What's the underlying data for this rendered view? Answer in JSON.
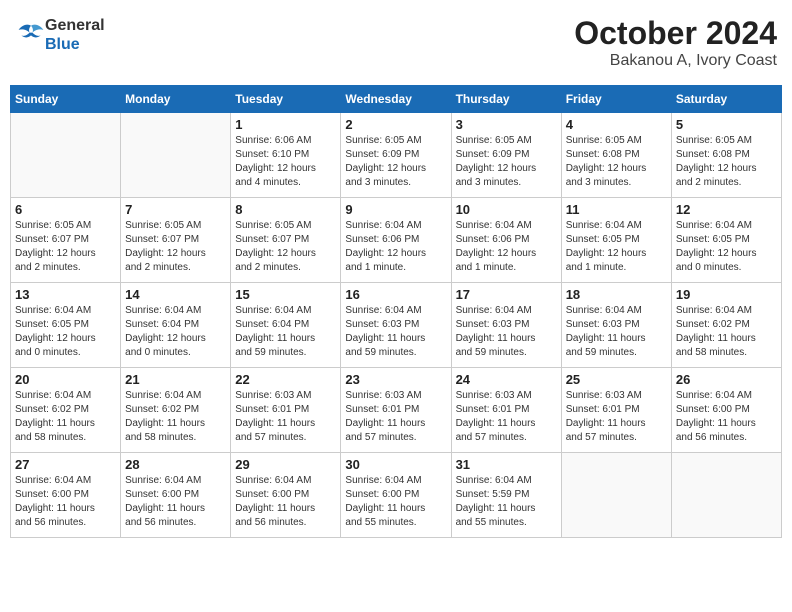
{
  "logo": {
    "general": "General",
    "blue": "Blue"
  },
  "title": "October 2024",
  "location": "Bakanou A, Ivory Coast",
  "days_of_week": [
    "Sunday",
    "Monday",
    "Tuesday",
    "Wednesday",
    "Thursday",
    "Friday",
    "Saturday"
  ],
  "weeks": [
    [
      {
        "day": "",
        "detail": ""
      },
      {
        "day": "",
        "detail": ""
      },
      {
        "day": "1",
        "detail": "Sunrise: 6:06 AM\nSunset: 6:10 PM\nDaylight: 12 hours\nand 4 minutes."
      },
      {
        "day": "2",
        "detail": "Sunrise: 6:05 AM\nSunset: 6:09 PM\nDaylight: 12 hours\nand 3 minutes."
      },
      {
        "day": "3",
        "detail": "Sunrise: 6:05 AM\nSunset: 6:09 PM\nDaylight: 12 hours\nand 3 minutes."
      },
      {
        "day": "4",
        "detail": "Sunrise: 6:05 AM\nSunset: 6:08 PM\nDaylight: 12 hours\nand 3 minutes."
      },
      {
        "day": "5",
        "detail": "Sunrise: 6:05 AM\nSunset: 6:08 PM\nDaylight: 12 hours\nand 2 minutes."
      }
    ],
    [
      {
        "day": "6",
        "detail": "Sunrise: 6:05 AM\nSunset: 6:07 PM\nDaylight: 12 hours\nand 2 minutes."
      },
      {
        "day": "7",
        "detail": "Sunrise: 6:05 AM\nSunset: 6:07 PM\nDaylight: 12 hours\nand 2 minutes."
      },
      {
        "day": "8",
        "detail": "Sunrise: 6:05 AM\nSunset: 6:07 PM\nDaylight: 12 hours\nand 2 minutes."
      },
      {
        "day": "9",
        "detail": "Sunrise: 6:04 AM\nSunset: 6:06 PM\nDaylight: 12 hours\nand 1 minute."
      },
      {
        "day": "10",
        "detail": "Sunrise: 6:04 AM\nSunset: 6:06 PM\nDaylight: 12 hours\nand 1 minute."
      },
      {
        "day": "11",
        "detail": "Sunrise: 6:04 AM\nSunset: 6:05 PM\nDaylight: 12 hours\nand 1 minute."
      },
      {
        "day": "12",
        "detail": "Sunrise: 6:04 AM\nSunset: 6:05 PM\nDaylight: 12 hours\nand 0 minutes."
      }
    ],
    [
      {
        "day": "13",
        "detail": "Sunrise: 6:04 AM\nSunset: 6:05 PM\nDaylight: 12 hours\nand 0 minutes."
      },
      {
        "day": "14",
        "detail": "Sunrise: 6:04 AM\nSunset: 6:04 PM\nDaylight: 12 hours\nand 0 minutes."
      },
      {
        "day": "15",
        "detail": "Sunrise: 6:04 AM\nSunset: 6:04 PM\nDaylight: 11 hours\nand 59 minutes."
      },
      {
        "day": "16",
        "detail": "Sunrise: 6:04 AM\nSunset: 6:03 PM\nDaylight: 11 hours\nand 59 minutes."
      },
      {
        "day": "17",
        "detail": "Sunrise: 6:04 AM\nSunset: 6:03 PM\nDaylight: 11 hours\nand 59 minutes."
      },
      {
        "day": "18",
        "detail": "Sunrise: 6:04 AM\nSunset: 6:03 PM\nDaylight: 11 hours\nand 59 minutes."
      },
      {
        "day": "19",
        "detail": "Sunrise: 6:04 AM\nSunset: 6:02 PM\nDaylight: 11 hours\nand 58 minutes."
      }
    ],
    [
      {
        "day": "20",
        "detail": "Sunrise: 6:04 AM\nSunset: 6:02 PM\nDaylight: 11 hours\nand 58 minutes."
      },
      {
        "day": "21",
        "detail": "Sunrise: 6:04 AM\nSunset: 6:02 PM\nDaylight: 11 hours\nand 58 minutes."
      },
      {
        "day": "22",
        "detail": "Sunrise: 6:03 AM\nSunset: 6:01 PM\nDaylight: 11 hours\nand 57 minutes."
      },
      {
        "day": "23",
        "detail": "Sunrise: 6:03 AM\nSunset: 6:01 PM\nDaylight: 11 hours\nand 57 minutes."
      },
      {
        "day": "24",
        "detail": "Sunrise: 6:03 AM\nSunset: 6:01 PM\nDaylight: 11 hours\nand 57 minutes."
      },
      {
        "day": "25",
        "detail": "Sunrise: 6:03 AM\nSunset: 6:01 PM\nDaylight: 11 hours\nand 57 minutes."
      },
      {
        "day": "26",
        "detail": "Sunrise: 6:04 AM\nSunset: 6:00 PM\nDaylight: 11 hours\nand 56 minutes."
      }
    ],
    [
      {
        "day": "27",
        "detail": "Sunrise: 6:04 AM\nSunset: 6:00 PM\nDaylight: 11 hours\nand 56 minutes."
      },
      {
        "day": "28",
        "detail": "Sunrise: 6:04 AM\nSunset: 6:00 PM\nDaylight: 11 hours\nand 56 minutes."
      },
      {
        "day": "29",
        "detail": "Sunrise: 6:04 AM\nSunset: 6:00 PM\nDaylight: 11 hours\nand 56 minutes."
      },
      {
        "day": "30",
        "detail": "Sunrise: 6:04 AM\nSunset: 6:00 PM\nDaylight: 11 hours\nand 55 minutes."
      },
      {
        "day": "31",
        "detail": "Sunrise: 6:04 AM\nSunset: 5:59 PM\nDaylight: 11 hours\nand 55 minutes."
      },
      {
        "day": "",
        "detail": ""
      },
      {
        "day": "",
        "detail": ""
      }
    ]
  ]
}
